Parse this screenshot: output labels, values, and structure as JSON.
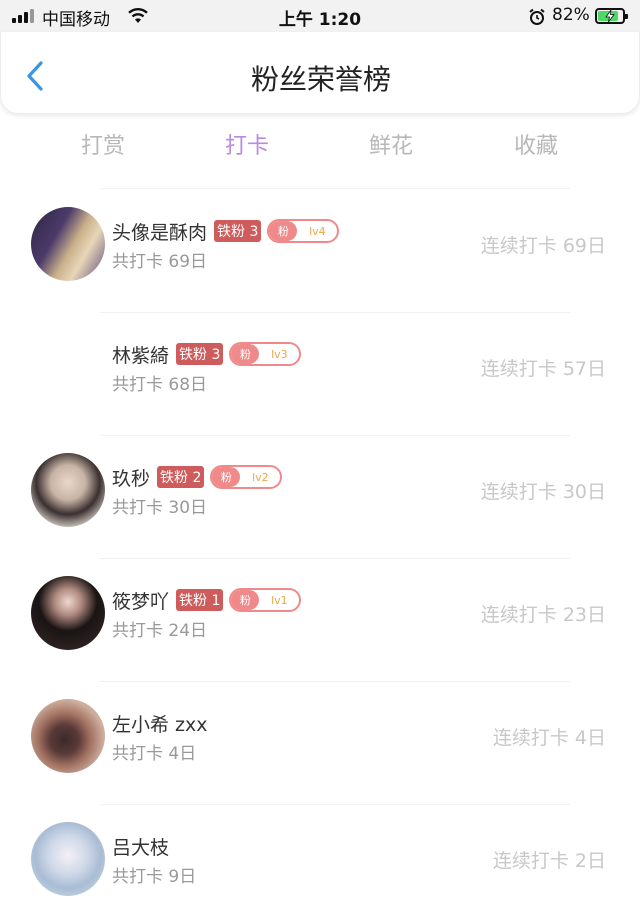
{
  "status_bar": {
    "carrier": "中国移动",
    "time": "上午 1:20",
    "battery_percent": "82%",
    "battery_level": 0.82
  },
  "header": {
    "title": "粉丝荣誉榜",
    "back_icon": "chevron-left-icon"
  },
  "tabs": [
    {
      "label": "打赏",
      "active": false
    },
    {
      "label": "打卡",
      "active": true
    },
    {
      "label": "鲜花",
      "active": false
    },
    {
      "label": "收藏",
      "active": false
    }
  ],
  "colors": {
    "accent": "#b98ae0",
    "back_icon": "#3a95e6",
    "iron_badge": "#cf5c5c",
    "fan_badge": "#f08a8a"
  },
  "fans": [
    {
      "name": "头像是酥肉",
      "iron_badge": "铁粉 3",
      "fan_badge": "粉",
      "level": "lv4",
      "total": "共打卡 69日",
      "streak": "连续打卡 69日",
      "avatar": true
    },
    {
      "name": "林紫綺",
      "iron_badge": "铁粉 3",
      "fan_badge": "粉",
      "level": "lv3",
      "total": "共打卡 68日",
      "streak": "连续打卡 57日",
      "avatar": false
    },
    {
      "name": "玖秒",
      "iron_badge": "铁粉 2",
      "fan_badge": "粉",
      "level": "lv2",
      "total": "共打卡 30日",
      "streak": "连续打卡 30日",
      "avatar": true
    },
    {
      "name": "筱梦吖",
      "iron_badge": "铁粉 1",
      "fan_badge": "粉",
      "level": "lv1",
      "total": "共打卡 24日",
      "streak": "连续打卡 23日",
      "avatar": true
    },
    {
      "name": "左小希 zxx",
      "total": "共打卡 4日",
      "streak": "连续打卡 4日",
      "avatar": true
    },
    {
      "name": "吕大枝",
      "total": "共打卡 9日",
      "streak": "连续打卡 2日",
      "avatar": true
    }
  ]
}
